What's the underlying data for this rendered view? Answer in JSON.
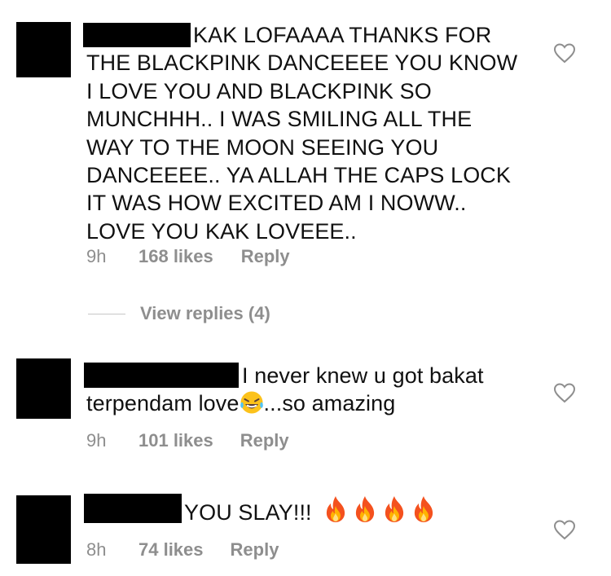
{
  "comments": [
    {
      "lines": [
        "KAK LOFAAAA THANKS FOR",
        "THE BLACKPINK DANCEEEE YOU KNOW",
        "I LOVE YOU AND BLACKPINK SO",
        "MUNCHHH.. I WAS SMILING ALL THE",
        "WAY TO THE MOON SEEING YOU",
        "DANCEEEE.. YA ALLAH THE CAPS LOCK",
        "IT WAS HOW EXCITED AM I NOWW..",
        "LOVE YOU KAK LOVEEE.."
      ],
      "time": "9h",
      "likes": "168 likes",
      "reply": "Reply",
      "view_replies": "View replies (4)"
    },
    {
      "line1": "I never knew u got bakat",
      "line2_prefix": "terpendam love",
      "line2_emoji": "face-with-tears-of-joy",
      "line2_suffix": "...so amazing",
      "time": "9h",
      "likes": "101 likes",
      "reply": "Reply"
    },
    {
      "text": "YOU SLAY!!!",
      "emoji": [
        "fire",
        "fire",
        "fire",
        "fire"
      ],
      "time": "8h",
      "likes": "74 likes",
      "reply": "Reply"
    }
  ],
  "colors": {
    "meta_gray": "#8e8e8e",
    "redaction": "#000000",
    "heart_outline": "#8e8e8e"
  }
}
